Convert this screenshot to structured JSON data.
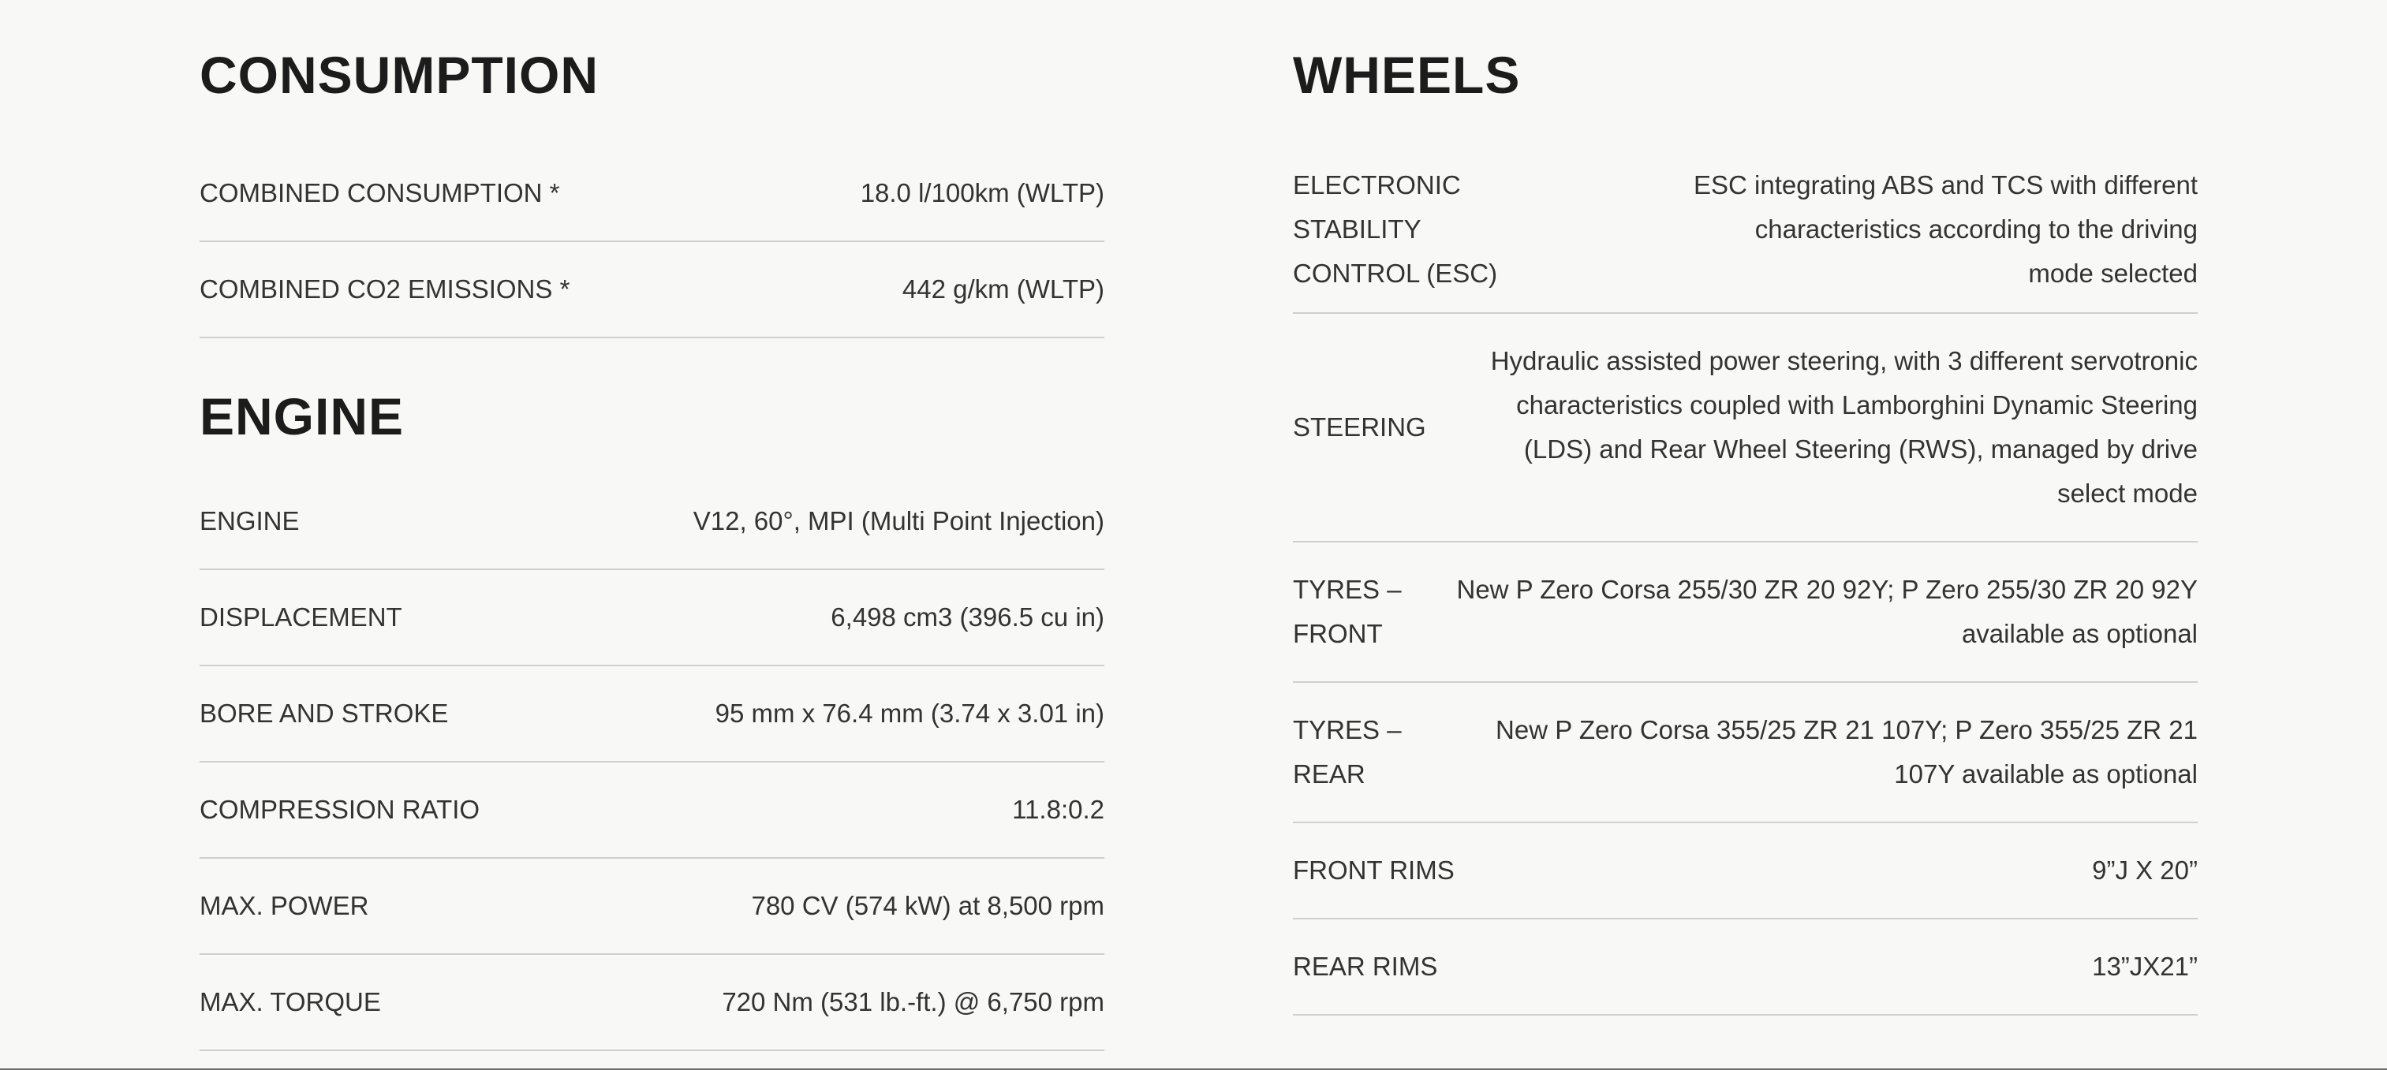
{
  "consumption": {
    "title": "CONSUMPTION",
    "rows": [
      {
        "label": "COMBINED CONSUMPTION *",
        "value": "18.0 l/100km (WLTP)"
      },
      {
        "label": "COMBINED CO2 EMISSIONS *",
        "value": "442 g/km (WLTP)"
      }
    ]
  },
  "engine": {
    "title": "ENGINE",
    "rows": [
      {
        "label": "ENGINE",
        "value": "V12, 60°, MPI (Multi Point Injection)"
      },
      {
        "label": "DISPLACEMENT",
        "value": "6,498 cm3 (396.5 cu in)"
      },
      {
        "label": "BORE AND STROKE",
        "value": "95 mm x 76.4 mm (3.74 x 3.01 in)"
      },
      {
        "label": "COMPRESSION RATIO",
        "value": "11.8:0.2"
      },
      {
        "label": "MAX. POWER",
        "value": "780 CV (574 kW) at 8,500 rpm"
      },
      {
        "label": "MAX. TORQUE",
        "value": "720 Nm (531 lb.-ft.) @ 6,750 rpm"
      }
    ]
  },
  "wheels": {
    "title": "WHEELS",
    "rows": [
      {
        "label": "ELECTRONIC STABILITY CONTROL (ESC)",
        "value": "ESC integrating ABS and TCS with different characteristics according to the driving mode selected"
      },
      {
        "label": "STEERING",
        "value": "Hydraulic assisted power steering, with 3 different servotronic characteristics coupled with Lamborghini Dynamic Steering (LDS) and Rear Wheel Steering (RWS), managed by drive select mode"
      },
      {
        "label": "TYRES – FRONT",
        "value": "New P Zero Corsa 255/30 ZR 20 92Y; P Zero 255/30 ZR 20 92Y available as optional"
      },
      {
        "label": "TYRES – REAR",
        "value": "New P Zero Corsa 355/25 ZR 21 107Y; P Zero 355/25 ZR 21 107Y available as optional"
      },
      {
        "label": "FRONT RIMS",
        "value": "9”J X 20”"
      },
      {
        "label": "REAR RIMS",
        "value": "13”JX21”"
      }
    ]
  }
}
